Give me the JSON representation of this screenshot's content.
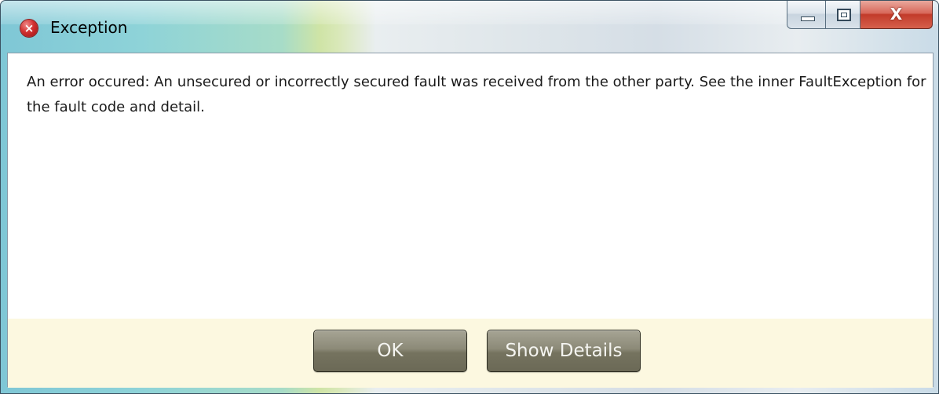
{
  "window": {
    "title": "Exception",
    "title_icon": "error-icon",
    "caption": {
      "minimize_icon": "minimize-icon",
      "maximize_icon": "maximize-icon",
      "close_icon": "close-icon",
      "close_glyph": "X"
    }
  },
  "dialog": {
    "message": "An error occured: An unsecured or incorrectly secured fault was received from the other party. See the inner FaultException for the fault code and detail."
  },
  "buttons": {
    "ok_label": "OK",
    "details_label": "Show Details"
  },
  "colors": {
    "footer_background": "#fcf8e0",
    "button_fill": "#8c8a78",
    "close_button": "#c23b2a"
  }
}
